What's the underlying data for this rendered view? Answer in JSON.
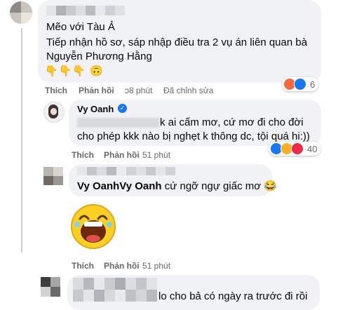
{
  "comment1": {
    "title": "Mẽo với Tàu Ả",
    "text_line1": "Tiếp nhận hồ sơ, sáp nhập điều tra 2 vụ án liên quan bà",
    "text_line2": "Nguyễn Phương Hằng",
    "emojis": "👇👇👇 🙃",
    "like": "Thích",
    "reply": "Phản hồi",
    "time_fragment": "ɔ8 phút",
    "edited": "Đã chỉnh sửa",
    "reaction_count": "6",
    "reaction_colors": [
      "#f0284a",
      "#1877f2"
    ]
  },
  "comment2": {
    "author": "Vy Oanh",
    "verified_color": "#1877f2",
    "text_line1_visible": "k ai cấm mơ, cứ mơ đi cho đời",
    "text_line2": "cho phép kkk nào bị nghẹt k thông dc, tội quá hi:))",
    "like": "Thích",
    "reply": "Phản hồi",
    "time": "51 phút",
    "reaction_count": "40",
    "reaction_colors": [
      "#1877f2",
      "#f7b125",
      "#f0284a"
    ]
  },
  "comment3": {
    "author_mention": "Vy OanhVy Oanh",
    "text": "cứ ngỡ ngự giấc mơ",
    "emoji_inline": "😂",
    "like": "Thích",
    "reply": "Phản hồi",
    "time": "51 phút"
  },
  "comment4": {
    "text_visible": "lo cho bả có ngày ra trước đi rồi"
  }
}
